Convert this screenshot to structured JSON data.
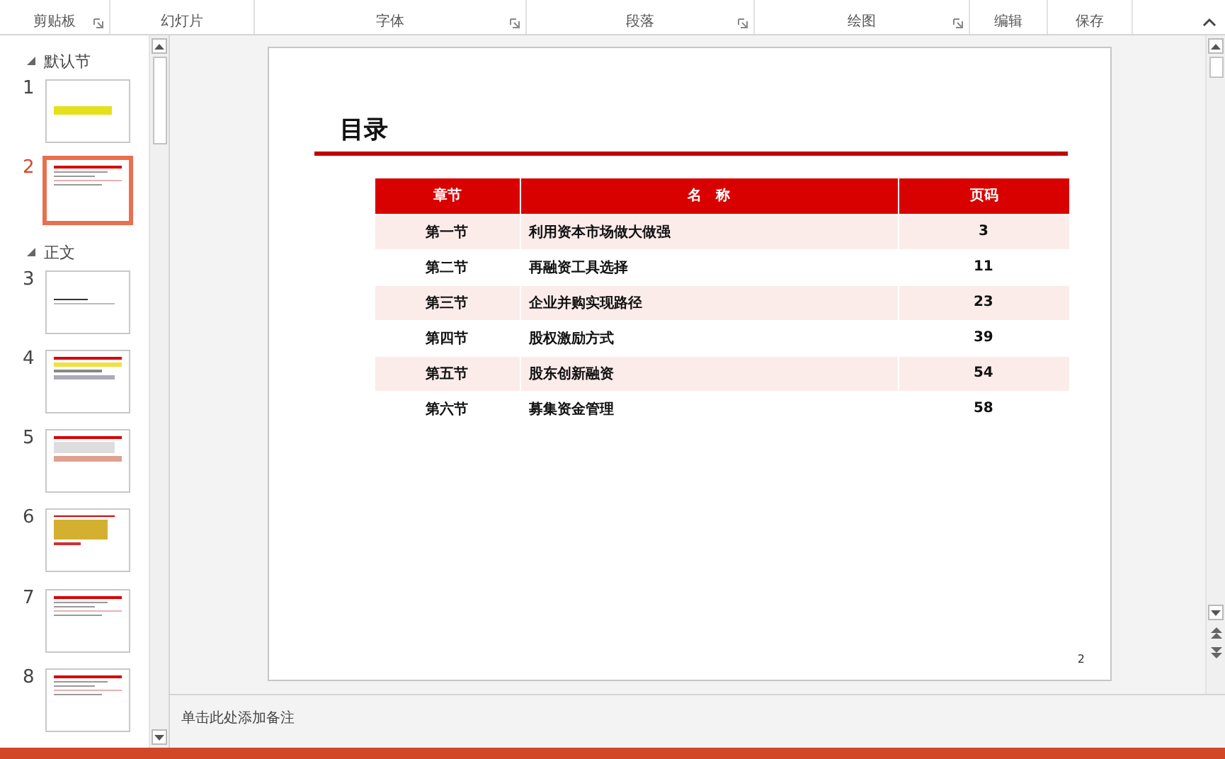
{
  "ribbon": {
    "groups": [
      {
        "label": "剪贴板",
        "launcher": true
      },
      {
        "label": "幻灯片",
        "launcher": false
      },
      {
        "label": "字体",
        "launcher": true
      },
      {
        "label": "段落",
        "launcher": true
      },
      {
        "label": "绘图",
        "launcher": true
      },
      {
        "label": "编辑",
        "launcher": false
      },
      {
        "label": "保存",
        "launcher": false
      }
    ]
  },
  "sections": [
    {
      "title": "默认节",
      "expanded": true,
      "slides": [
        {
          "number": "1",
          "kind": "title",
          "selected": false
        },
        {
          "number": "2",
          "kind": "table",
          "selected": true
        }
      ]
    },
    {
      "title": "正文",
      "expanded": true,
      "slides": [
        {
          "number": "3",
          "kind": "blank",
          "selected": false
        },
        {
          "number": "4",
          "kind": "diagram",
          "selected": false
        },
        {
          "number": "5",
          "kind": "chart",
          "selected": false
        },
        {
          "number": "6",
          "kind": "map",
          "selected": false
        },
        {
          "number": "7",
          "kind": "table",
          "selected": false
        },
        {
          "number": "8",
          "kind": "table",
          "selected": false
        }
      ]
    }
  ],
  "slide": {
    "title": "目录",
    "table": {
      "columns": [
        "章节",
        "名　称",
        "页码"
      ],
      "rows": [
        [
          "第一节",
          "利用资本市场做大做强",
          "3"
        ],
        [
          "第二节",
          "再融资工具选择",
          "11"
        ],
        [
          "第三节",
          "企业并购实现路径",
          "23"
        ],
        [
          "第四节",
          "股权激励方式",
          "39"
        ],
        [
          "第五节",
          "股东创新融资",
          "54"
        ],
        [
          "第六节",
          "募集资金管理",
          "58"
        ]
      ]
    },
    "page_number": "2"
  },
  "notes": {
    "placeholder": "单击此处添加备注"
  }
}
